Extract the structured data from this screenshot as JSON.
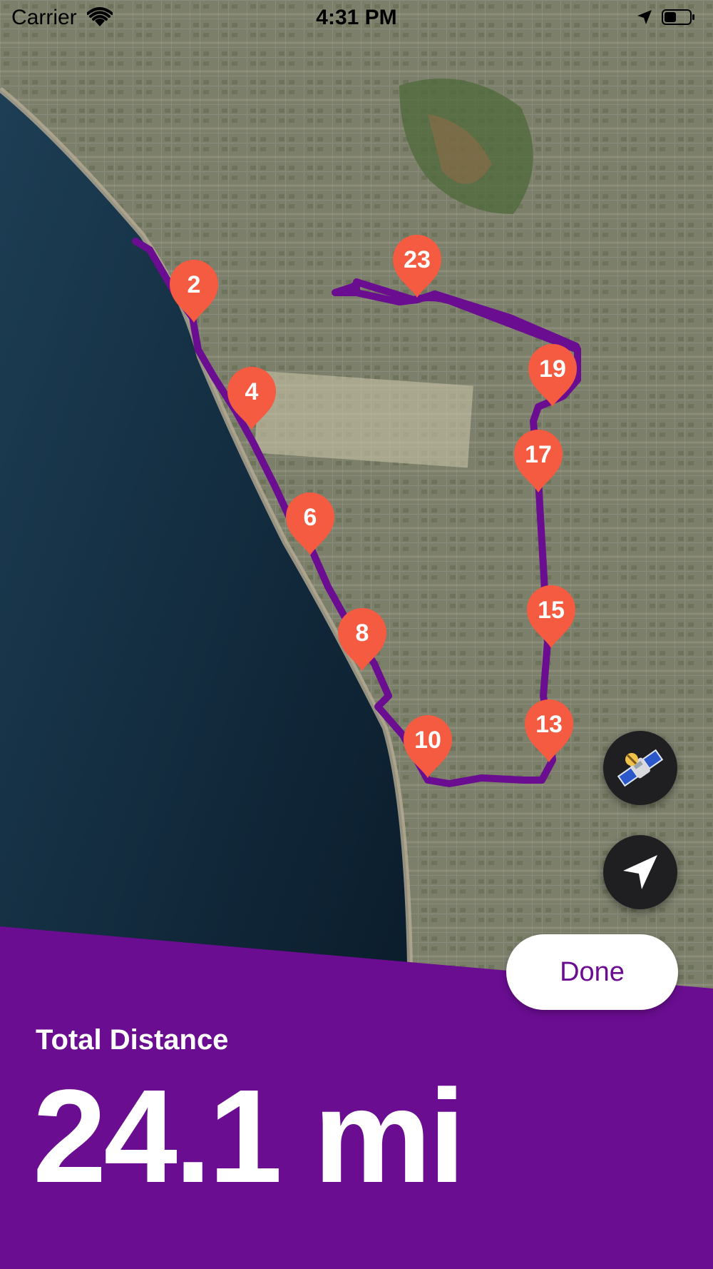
{
  "status_bar": {
    "carrier": "Carrier",
    "time": "4:31 PM"
  },
  "map": {
    "mode": "satellite",
    "route_color": "#6a0d91",
    "marker_color": "#f45b40",
    "markers": [
      {
        "label": "2"
      },
      {
        "label": "4"
      },
      {
        "label": "6"
      },
      {
        "label": "8"
      },
      {
        "label": "10"
      },
      {
        "label": "13"
      },
      {
        "label": "15"
      },
      {
        "label": "17"
      },
      {
        "label": "19"
      },
      {
        "label": "23"
      }
    ]
  },
  "controls": {
    "map_type_icon": "satellite-icon",
    "locate_icon": "location-arrow-icon"
  },
  "summary": {
    "done_label": "Done",
    "total_label": "Total Distance",
    "total_value": "24.1 mi",
    "accent_color": "#6a0d91"
  }
}
